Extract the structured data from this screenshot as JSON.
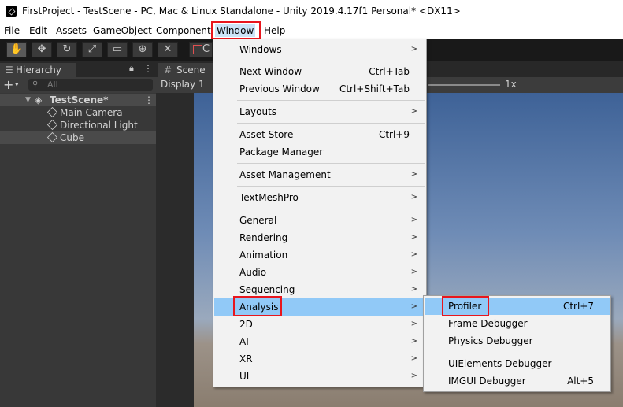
{
  "window": {
    "title": "FirstProject - TestScene - PC, Mac & Linux Standalone - Unity 2019.4.17f1 Personal* <DX11>"
  },
  "menubar": [
    "File",
    "Edit",
    "Assets",
    "GameObject",
    "Component",
    "Window",
    "Help"
  ],
  "toolbar": {
    "tools": [
      "hand-icon",
      "move-icon",
      "rotate-icon",
      "scale-icon",
      "rect-icon",
      "transform-icon",
      "custom-tool-icon"
    ],
    "center_partial": "C"
  },
  "hierarchy": {
    "tab_label": "Hierarchy",
    "search_placeholder": "All",
    "scene_name": "TestScene*",
    "objects": [
      "Main Camera",
      "Directional Light",
      "Cube"
    ]
  },
  "scene": {
    "tab_label": "Scene",
    "display": "Display 1",
    "scale_label": "1x"
  },
  "window_menu": {
    "items": [
      {
        "label": "Windows",
        "shortcut": "",
        "submenu": true
      },
      {
        "label": "Next Window",
        "shortcut": "Ctrl+Tab",
        "submenu": false
      },
      {
        "label": "Previous Window",
        "shortcut": "Ctrl+Shift+Tab",
        "submenu": false
      },
      {
        "label": "Layouts",
        "shortcut": "",
        "submenu": true
      },
      {
        "label": "Asset Store",
        "shortcut": "Ctrl+9",
        "submenu": false
      },
      {
        "label": "Package Manager",
        "shortcut": "",
        "submenu": false
      },
      {
        "label": "Asset Management",
        "shortcut": "",
        "submenu": true
      },
      {
        "label": "TextMeshPro",
        "shortcut": "",
        "submenu": true
      },
      {
        "label": "General",
        "shortcut": "",
        "submenu": true
      },
      {
        "label": "Rendering",
        "shortcut": "",
        "submenu": true
      },
      {
        "label": "Animation",
        "shortcut": "",
        "submenu": true
      },
      {
        "label": "Audio",
        "shortcut": "",
        "submenu": true
      },
      {
        "label": "Sequencing",
        "shortcut": "",
        "submenu": true
      },
      {
        "label": "Analysis",
        "shortcut": "",
        "submenu": true
      },
      {
        "label": "2D",
        "shortcut": "",
        "submenu": true
      },
      {
        "label": "AI",
        "shortcut": "",
        "submenu": true
      },
      {
        "label": "XR",
        "shortcut": "",
        "submenu": true
      },
      {
        "label": "UI",
        "shortcut": "",
        "submenu": true
      }
    ],
    "highlighted": "Analysis"
  },
  "analysis_submenu": {
    "items": [
      {
        "label": "Profiler",
        "shortcut": "Ctrl+7"
      },
      {
        "label": "Frame Debugger",
        "shortcut": ""
      },
      {
        "label": "Physics Debugger",
        "shortcut": ""
      },
      {
        "label": "UIElements Debugger",
        "shortcut": ""
      },
      {
        "label": "IMGUI Debugger",
        "shortcut": "Alt+5"
      }
    ],
    "highlighted": "Profiler"
  },
  "colors": {
    "highlight": "#91c9f7",
    "annotation": "#e8161d",
    "toolbar_dark": "#191919",
    "panel_dark": "#383838"
  }
}
